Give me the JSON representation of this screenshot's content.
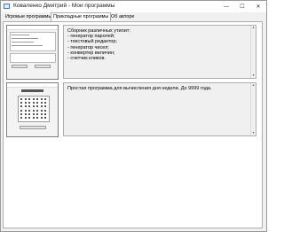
{
  "window": {
    "title": "Коваленко Дмитрий - Мои программы",
    "controls": {
      "minimize": "—",
      "maximize": "☐",
      "close": "✕"
    }
  },
  "tabs": [
    {
      "label": "Игровые программы",
      "selected": false
    },
    {
      "label": "Прикладные программы",
      "selected": true
    },
    {
      "label": "Об авторе",
      "selected": false
    }
  ],
  "programs": [
    {
      "description_lines": [
        "Сборник различных утилит:",
        "- генератор паролей;",
        "- текстовый редактор;",
        "- генератор чисел;",
        "- конвертер величин;",
        "- счетчик кликов."
      ]
    },
    {
      "description_lines": [
        "Простая программа для вычисления дня недели. До 9999 года."
      ]
    }
  ],
  "scrollbar": {
    "up": "▲",
    "down": "▼"
  },
  "colors": {
    "accent": "#3a7bd5",
    "panel": "#f0f0f0",
    "border": "#adadad"
  }
}
